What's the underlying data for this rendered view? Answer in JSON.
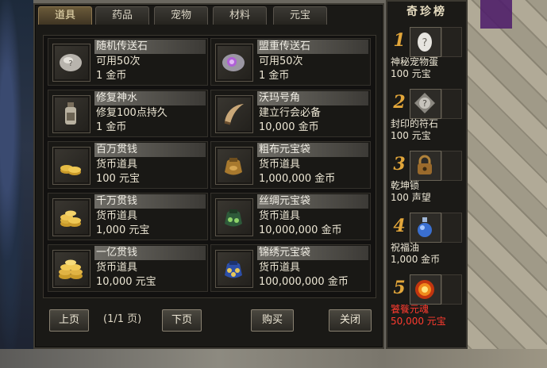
{
  "tabs": [
    {
      "label": "道具",
      "active": true
    },
    {
      "label": "药品",
      "active": false
    },
    {
      "label": "宠物",
      "active": false
    },
    {
      "label": "材料",
      "active": false
    },
    {
      "label": "元宝",
      "active": false
    }
  ],
  "items": [
    {
      "name": "随机传送石",
      "desc": "可用50次",
      "price": "1 金币",
      "icon": "gray-stone-icon"
    },
    {
      "name": "盟重传送石",
      "desc": "可用50次",
      "price": "1 金币",
      "icon": "purple-stone-icon"
    },
    {
      "name": "修复神水",
      "desc": "修复100点持久",
      "price": "1 金币",
      "icon": "potion-bottle-icon"
    },
    {
      "name": "沃玛号角",
      "desc": "建立行会必备",
      "price": "10,000 金币",
      "icon": "horn-icon"
    },
    {
      "name": "百万贯钱",
      "desc": "货币道具",
      "price": "100 元宝",
      "icon": "coin-stack-small-icon"
    },
    {
      "name": "粗布元宝袋",
      "desc": "货币道具",
      "price": "1,000,000 金币",
      "icon": "cloth-bag-icon"
    },
    {
      "name": "千万贯钱",
      "desc": "货币道具",
      "price": "1,000 元宝",
      "icon": "coin-stack-medium-icon"
    },
    {
      "name": "丝绸元宝袋",
      "desc": "货币道具",
      "price": "10,000,000 金币",
      "icon": "silk-bag-icon"
    },
    {
      "name": "一亿贯钱",
      "desc": "货币道具",
      "price": "10,000 元宝",
      "icon": "coin-stack-large-icon"
    },
    {
      "name": "锦绣元宝袋",
      "desc": "货币道具",
      "price": "100,000,000 金币",
      "icon": "brocade-bag-icon"
    }
  ],
  "buttons": {
    "prev": "上页",
    "page_info": "(1/1 页)",
    "next": "下页",
    "buy": "购买",
    "close": "关闭"
  },
  "side": {
    "title": "奇珍榜",
    "items": [
      {
        "rank": "1",
        "name": "神秘宠物蛋",
        "price": "100 元宝",
        "icon": "mystery-egg-icon"
      },
      {
        "rank": "2",
        "name": "封印的符石",
        "price": "100 元宝",
        "icon": "sealed-rune-icon"
      },
      {
        "rank": "3",
        "name": "乾坤锁",
        "price": "100 声望",
        "icon": "lock-icon"
      },
      {
        "rank": "4",
        "name": "祝福油",
        "price": "1,000 金币",
        "icon": "blessing-oil-icon"
      },
      {
        "rank": "5",
        "name": "饕餮元魂",
        "price": "50,000 元宝",
        "icon": "flame-soul-icon",
        "highlight": true
      }
    ]
  },
  "colors": {
    "accent_gold": "#e2a63a",
    "highlight_red": "#ff3b2f",
    "panel_bg": "#1a1916"
  }
}
